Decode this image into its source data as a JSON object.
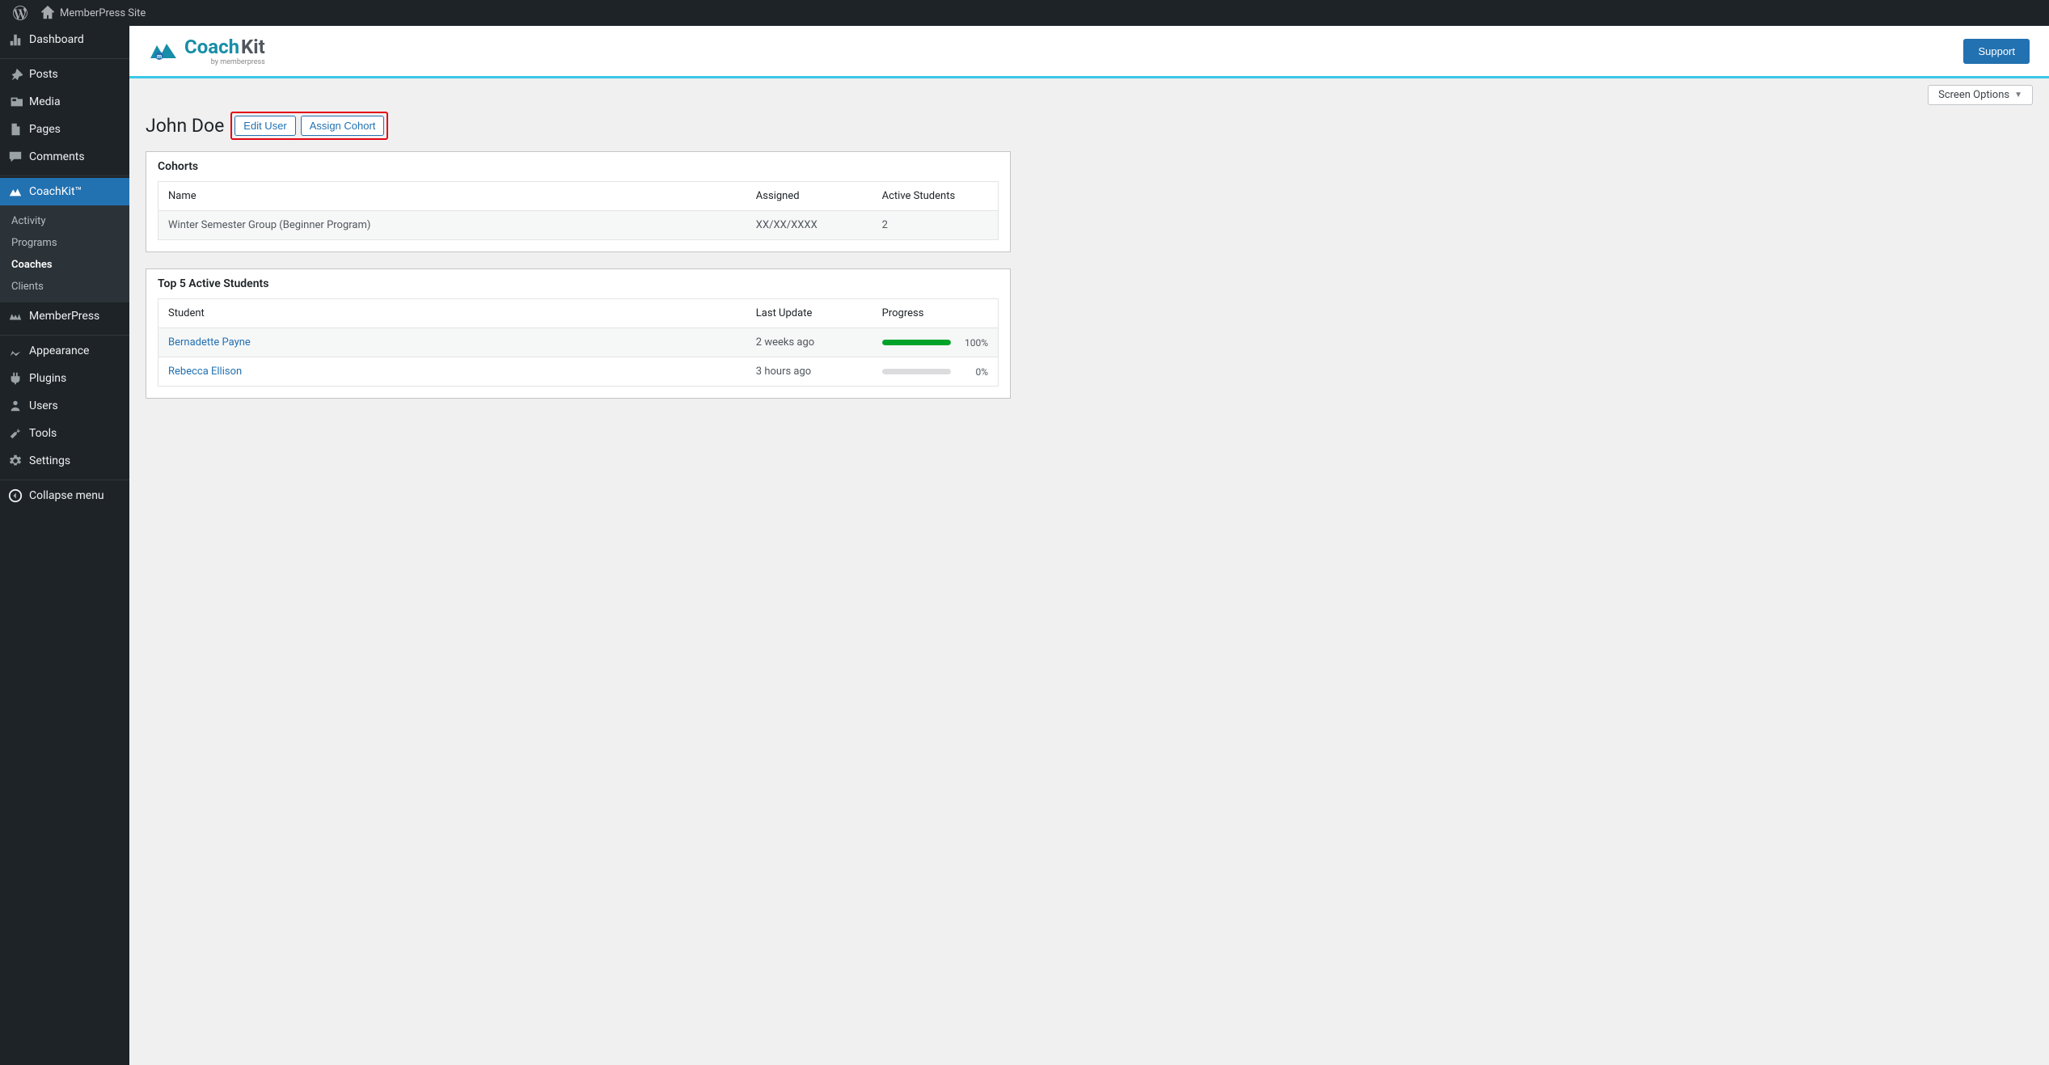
{
  "site_name": "MemberPress Site",
  "logo": {
    "brand_prefix": "Coach",
    "brand_suffix": "Kit",
    "sub": "by memberpress"
  },
  "support_label": "Support",
  "screen_options_label": "Screen Options",
  "sidebar": {
    "items": [
      {
        "label": "Dashboard"
      },
      {
        "label": "Posts"
      },
      {
        "label": "Media"
      },
      {
        "label": "Pages"
      },
      {
        "label": "Comments"
      },
      {
        "label": "CoachKit™"
      },
      {
        "label": "MemberPress"
      },
      {
        "label": "Appearance"
      },
      {
        "label": "Plugins"
      },
      {
        "label": "Users"
      },
      {
        "label": "Tools"
      },
      {
        "label": "Settings"
      },
      {
        "label": "Collapse menu"
      }
    ],
    "coachkit_sub": [
      {
        "label": "Activity"
      },
      {
        "label": "Programs"
      },
      {
        "label": "Coaches"
      },
      {
        "label": "Clients"
      }
    ]
  },
  "page": {
    "title": "John Doe",
    "edit_user": "Edit User",
    "assign_cohort": "Assign Cohort"
  },
  "cohorts_panel": {
    "title": "Cohorts",
    "headers": {
      "name": "Name",
      "assigned": "Assigned",
      "active": "Active Students"
    },
    "rows": [
      {
        "name": "Winter Semester Group (Beginner Program)",
        "assigned": "XX/XX/XXXX",
        "active": "2"
      }
    ]
  },
  "students_panel": {
    "title": "Top 5 Active Students",
    "headers": {
      "student": "Student",
      "last_update": "Last Update",
      "progress": "Progress"
    },
    "rows": [
      {
        "student": "Bernadette Payne",
        "last_update": "2 weeks ago",
        "progress": 100
      },
      {
        "student": "Rebecca Ellison",
        "last_update": "3 hours ago",
        "progress": 0
      }
    ]
  }
}
